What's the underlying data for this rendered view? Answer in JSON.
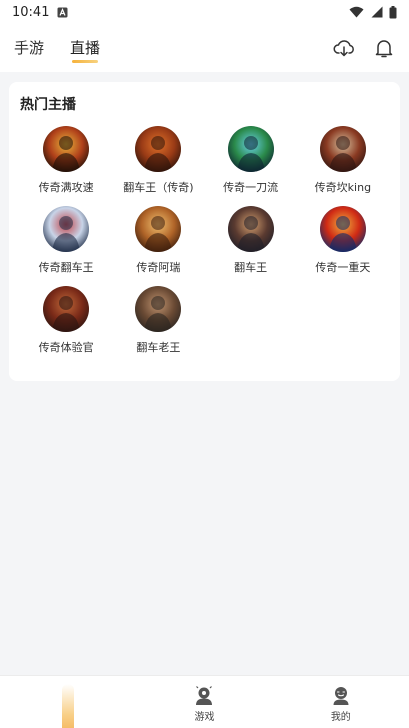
{
  "status_bar": {
    "time": "10:41",
    "notification_icon": "letter-a-icon",
    "wifi_icon": "wifi-icon",
    "signal_icon": "signal-icon",
    "battery_icon": "battery-icon"
  },
  "top_nav": {
    "tabs": [
      {
        "label": "手游",
        "active": false
      },
      {
        "label": "直播",
        "active": true
      }
    ],
    "download_icon": "cloud-download-icon",
    "bell_icon": "bell-icon",
    "accent_color": "#f6b23c"
  },
  "hot_streamers": {
    "title": "热门主播",
    "items": [
      {
        "name": "传奇满攻速",
        "colors": [
          "#1a0e07",
          "#b0401a",
          "#e8b43c"
        ]
      },
      {
        "name": "翻车王（传奇)",
        "colors": [
          "#2a120a",
          "#9a3b16",
          "#e0722a"
        ]
      },
      {
        "name": "传奇一刀流",
        "colors": [
          "#0c2030",
          "#2a8a4a",
          "#6ad0e8"
        ]
      },
      {
        "name": "传奇坎king",
        "colors": [
          "#2c1410",
          "#8a3a22",
          "#d8c2a0"
        ]
      },
      {
        "name": "传奇翻车王",
        "colors": [
          "#1c2a44",
          "#c8d4e8",
          "#c0444a"
        ]
      },
      {
        "name": "传奇阿瑞",
        "colors": [
          "#3a1c0c",
          "#b06428",
          "#f0c070"
        ]
      },
      {
        "name": "翻车王",
        "colors": [
          "#1e1e28",
          "#5a3a30",
          "#d4a070"
        ]
      },
      {
        "name": "传奇一重天",
        "colors": [
          "#0a2a6a",
          "#d02a14",
          "#f0b040"
        ]
      },
      {
        "name": "传奇体验官",
        "colors": [
          "#2a1410",
          "#7a2a18",
          "#c06a3a"
        ]
      },
      {
        "name": "翻车老王",
        "colors": [
          "#2a2420",
          "#6a4a34",
          "#c09470"
        ]
      }
    ]
  },
  "bottom_nav": {
    "items": [
      {
        "label": "",
        "icon": "home-glow-icon"
      },
      {
        "label": "游戏",
        "icon": "game-icon"
      },
      {
        "label": "我的",
        "icon": "profile-icon"
      }
    ]
  }
}
